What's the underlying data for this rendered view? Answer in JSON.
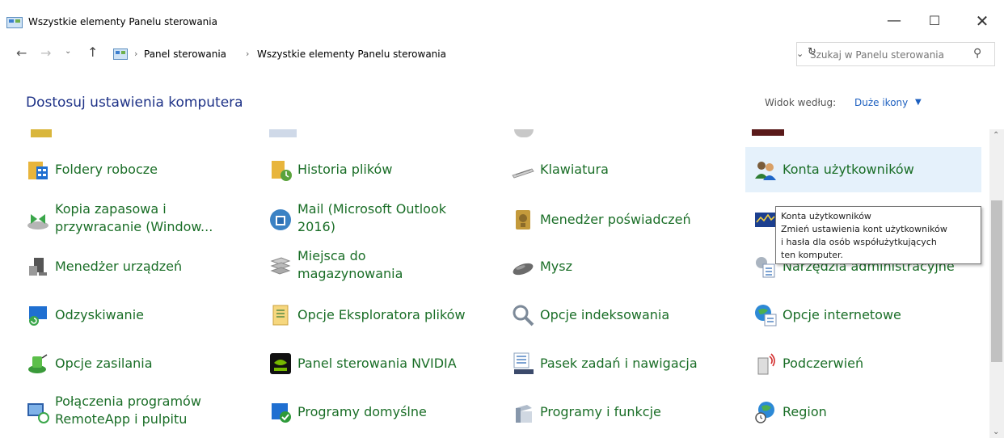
{
  "window": {
    "title": "Wszystkie elementy Panelu sterowania"
  },
  "nav": {
    "breadcrumbs": [
      "Panel sterowania",
      "Wszystkie elementy Panelu sterowania"
    ],
    "search_placeholder": "Szukaj w Panelu sterowania"
  },
  "header": {
    "title": "Dostosuj ustawienia komputera",
    "view_by_label": "Widok według:",
    "view_by_value": "Duże ikony"
  },
  "items": [
    {
      "label": "Foldery robocze",
      "icon": "work-folders-icon"
    },
    {
      "label": "Historia plików",
      "icon": "file-history-icon"
    },
    {
      "label": "Klawiatura",
      "icon": "keyboard-icon"
    },
    {
      "label": "Konta użytkowników",
      "icon": "user-accounts-icon"
    },
    {
      "label": "Kopia zapasowa i przywracanie (Window...",
      "icon": "backup-icon"
    },
    {
      "label": "Mail (Microsoft Outlook 2016)",
      "icon": "mail-icon"
    },
    {
      "label": "Menedżer poświadczeń",
      "icon": "credential-manager-icon"
    },
    {
      "label": "Menedżer urządzeń",
      "icon": "device-manager-icon"
    },
    {
      "label": "Miejsca do magazynowania",
      "icon": "storage-spaces-icon"
    },
    {
      "label": "Mysz",
      "icon": "mouse-icon"
    },
    {
      "label": "Narzędzia administracyjne",
      "icon": "admin-tools-icon"
    },
    {
      "label": "Odzyskiwanie",
      "icon": "recovery-icon"
    },
    {
      "label": "Opcje Eksploratora plików",
      "icon": "explorer-options-icon"
    },
    {
      "label": "Opcje indeksowania",
      "icon": "indexing-icon"
    },
    {
      "label": "Opcje internetowe",
      "icon": "internet-options-icon"
    },
    {
      "label": "Opcje zasilania",
      "icon": "power-options-icon"
    },
    {
      "label": "Panel sterowania NVIDIA",
      "icon": "nvidia-icon"
    },
    {
      "label": "Pasek zadań i nawigacja",
      "icon": "taskbar-icon"
    },
    {
      "label": "Podczerwień",
      "icon": "infrared-icon"
    },
    {
      "label": "Połączenia programów RemoteApp i pulpitu",
      "icon": "remoteapp-icon"
    },
    {
      "label": "Programy domyślne",
      "icon": "default-programs-icon"
    },
    {
      "label": "Programy i funkcje",
      "icon": "programs-features-icon"
    },
    {
      "label": "Region",
      "icon": "region-icon"
    }
  ],
  "tooltip": {
    "title": "Konta użytkowników",
    "lines": [
      "Zmień ustawienia kont użytkowników",
      "i hasła dla osób współużytkujących",
      "ten komputer."
    ]
  }
}
